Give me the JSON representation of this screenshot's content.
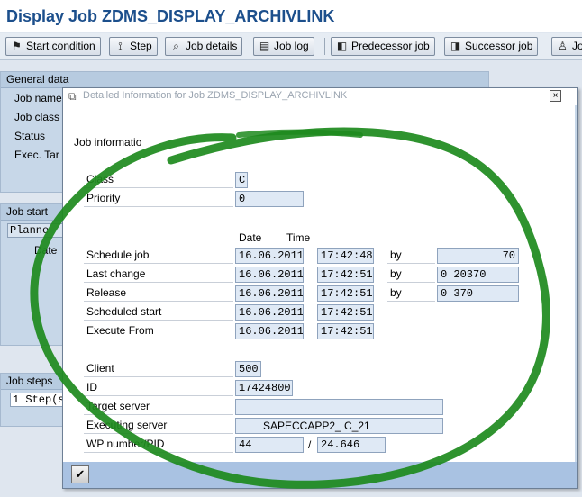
{
  "window": {
    "title": "Display Job ZDMS_DISPLAY_ARCHIVLINK"
  },
  "toolbar": {
    "buttons": [
      {
        "label": "Start condition",
        "icon": "flag-icon"
      },
      {
        "label": "Step",
        "icon": "step-icon"
      },
      {
        "label": "Job details",
        "icon": "magnifier-icon"
      },
      {
        "label": "Job log",
        "icon": "log-icon"
      },
      {
        "label": "Predecessor job",
        "icon": "predecessor-icon"
      },
      {
        "label": "Successor job",
        "icon": "successor-icon"
      },
      {
        "label": "Jo",
        "icon": "person-icon"
      }
    ]
  },
  "background": {
    "general_data": {
      "header": "General data",
      "labels": [
        "Job name",
        "Job class",
        "Status",
        "Exec. Tar"
      ]
    },
    "job_start": {
      "header": "Job start",
      "planned": "Planne",
      "date": "Date"
    },
    "job_steps": {
      "header": "Job steps",
      "value": "1 Step(s"
    }
  },
  "dialog": {
    "title": "Detailed Information for Job ZDMS_DISPLAY_ARCHIVLINK",
    "close_symbol": "×",
    "job_information_label": "Job informatio",
    "class_label": "Class",
    "class_value": "C",
    "priority_label": "Priority",
    "priority_value": "0",
    "date_header": "Date",
    "time_header": "Time",
    "rows": [
      {
        "label": "Schedule job",
        "date": "16.06.2011",
        "time": "17:42:48",
        "by": "by",
        "user": "70"
      },
      {
        "label": "Last change",
        "date": "16.06.2011",
        "time": "17:42:51",
        "by": "by",
        "user": "0   20370"
      },
      {
        "label": "Release",
        "date": "16.06.2011",
        "time": "17:42:51",
        "by": "by",
        "user": "0     370"
      },
      {
        "label": "Scheduled start",
        "date": "16.06.2011",
        "time": "17:42:51"
      },
      {
        "label": "Execute From",
        "date": "16.06.2011",
        "time": "17:42:51"
      }
    ],
    "client_label": "Client",
    "client_value": "500",
    "id_label": "ID",
    "id_value": "17424800",
    "target_server_label": "Target server",
    "target_server_value": "",
    "executing_server_label": "Executing server",
    "executing_server_value": "SAPECCAPP2_   C_21",
    "wp_label": "WP number/PID",
    "wp_value": "44",
    "pid_separator": "/",
    "pid_value": "24.646",
    "ok_symbol": "✔"
  },
  "colors": {
    "title_blue": "#1c4f8c",
    "field_bg": "#dfe9f5",
    "footer_blue": "#a9c2e2",
    "marker_green": "#1d8a1d"
  }
}
